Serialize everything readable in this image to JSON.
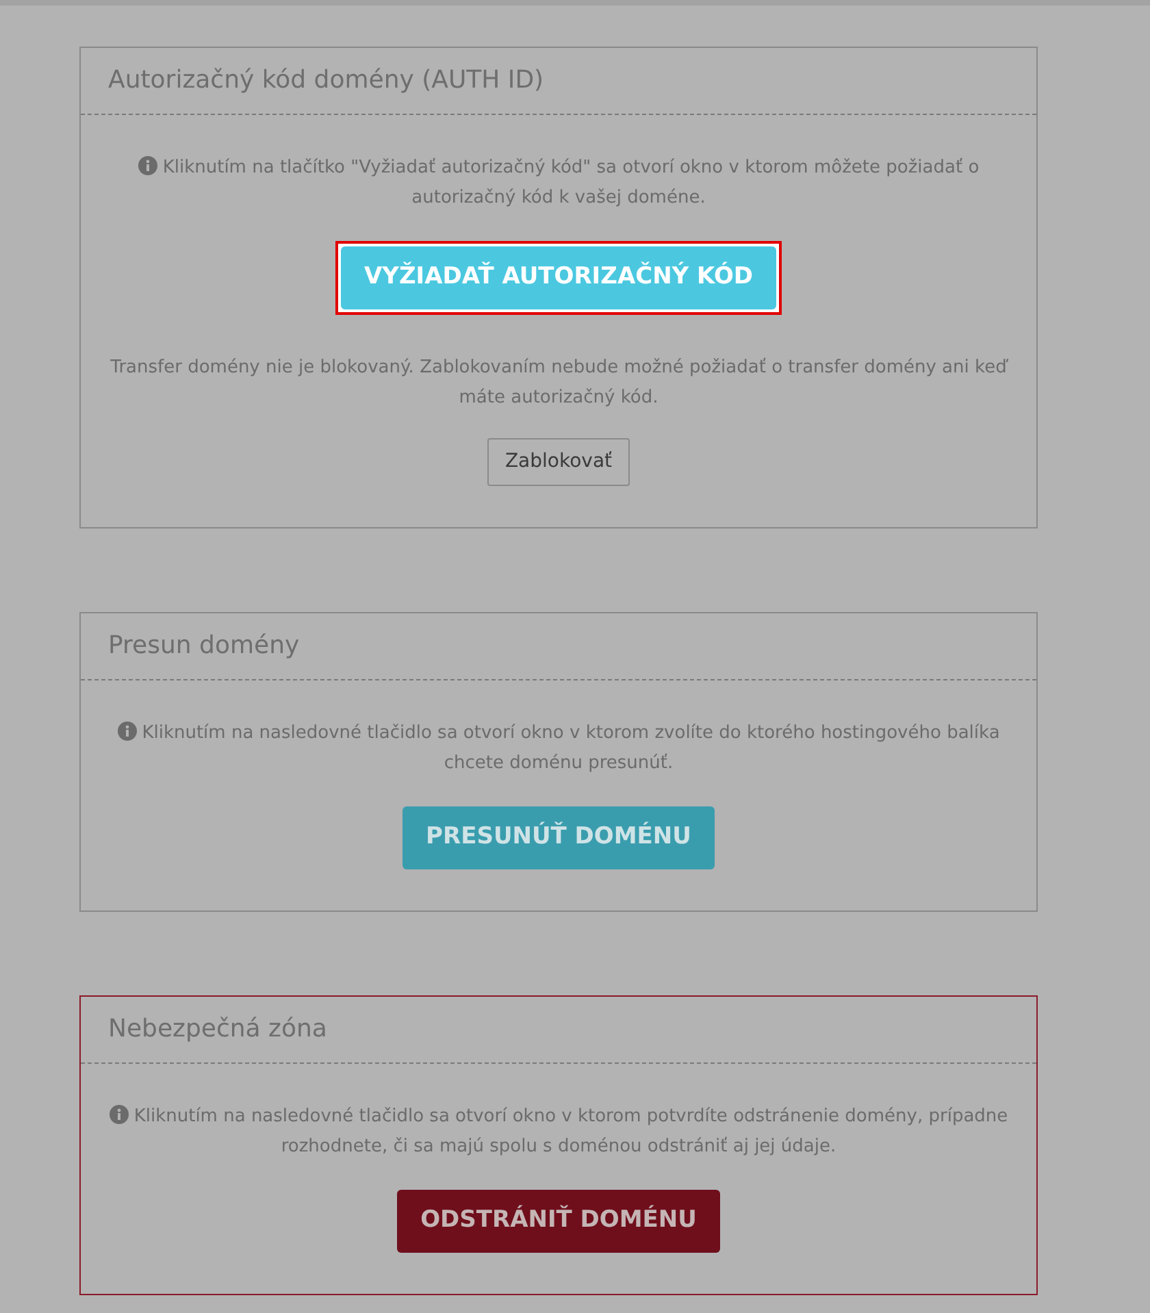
{
  "panels": [
    {
      "title": "Autorizačný kód domény (AUTH ID)",
      "kind": "default",
      "blocks": [
        {
          "kind": "info",
          "text": "Kliknutím na tlačítko \"Vyžiadať autorizačný kód\" sa otvorí okno v ktorom môžete požiadať o autorizačný kód k vašej doméne."
        },
        {
          "kind": "action",
          "label": "VYŽIADAŤ AUTORIZAČNÝ KÓD",
          "highlighted": true
        },
        {
          "kind": "text",
          "text": "Transfer domény nie je blokovaný. Zablokovaním nebude možné požiadať o transfer domény ani keď máte autorizačný kód."
        },
        {
          "kind": "plain",
          "label": "Zablokovať",
          "highlighted": false
        }
      ]
    },
    {
      "title": "Presun domény",
      "kind": "default",
      "blocks": [
        {
          "kind": "info",
          "text": "Kliknutím na nasledovné tlačidlo sa otvorí okno v ktorom zvolíte do ktorého hostingového balíka chcete doménu presunúť."
        },
        {
          "kind": "action",
          "label": "PRESUNÚŤ DOMÉNU",
          "highlighted": false
        }
      ]
    },
    {
      "title": "Nebezpečná zóna",
      "kind": "danger",
      "blocks": [
        {
          "kind": "info",
          "text": "Kliknutím na nasledovné tlačidlo sa otvorí okno v ktorom potvrdíte odstránenie domény, prípadne rozhodnete, či sa majú spolu s doménou odstrániť aj jej údaje."
        },
        {
          "kind": "delete",
          "label": "ODSTRÁNIŤ DOMÉNU",
          "highlighted": false
        }
      ]
    }
  ]
}
